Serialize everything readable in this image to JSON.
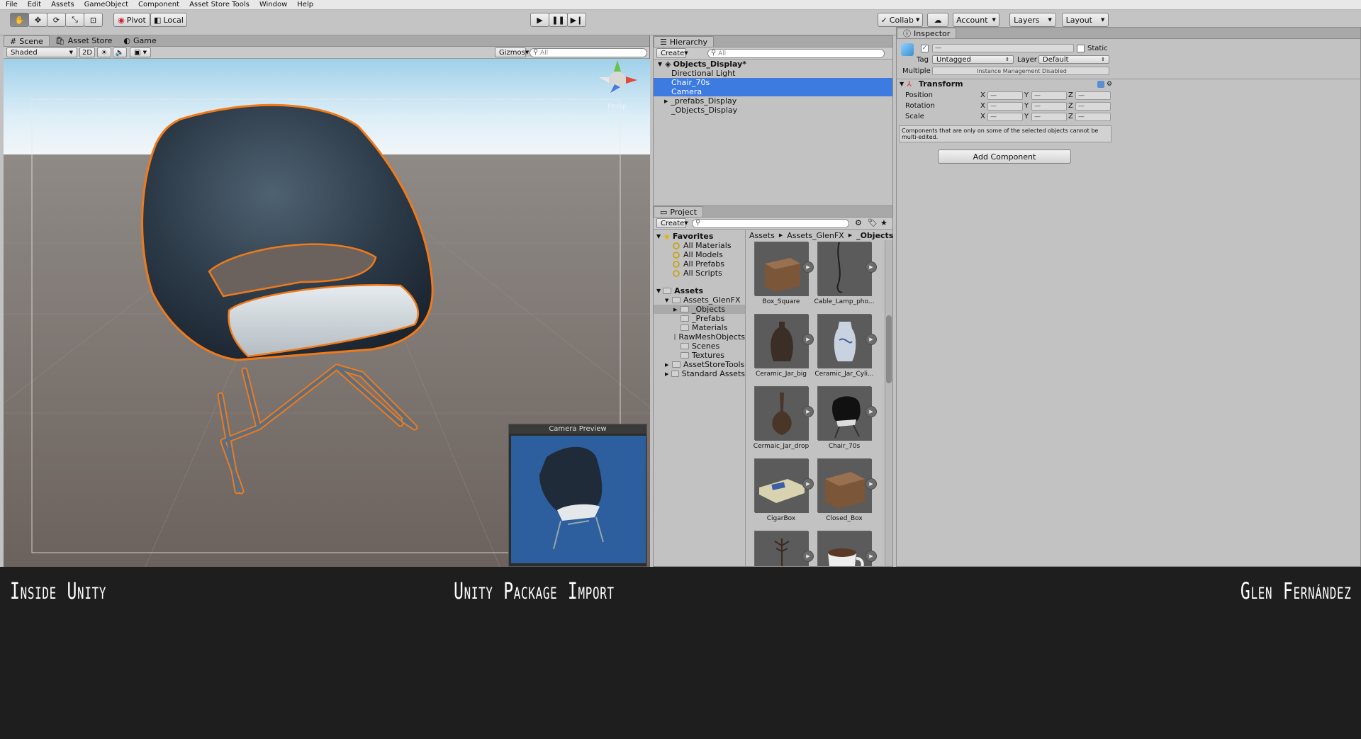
{
  "menu": [
    "File",
    "Edit",
    "Assets",
    "GameObject",
    "Component",
    "Asset Store Tools",
    "Window",
    "Help"
  ],
  "toolbar": {
    "pivot": "Pivot",
    "local": "Local",
    "collab": "Collab",
    "account": "Account",
    "layers": "Layers",
    "layout": "Layout"
  },
  "scene": {
    "tabs": [
      "Scene",
      "Asset Store",
      "Game"
    ],
    "shading": "Shaded",
    "mode2d": "2D",
    "gizmos": "Gizmos",
    "search_placeholder": "All",
    "persp": "Persp",
    "camera_preview_title": "Camera Preview"
  },
  "hierarchy": {
    "title": "Hierarchy",
    "create": "Create",
    "search_placeholder": "All",
    "root": "Objects_Display*",
    "items": [
      {
        "label": "Directional Light",
        "selected": false,
        "expandable": false
      },
      {
        "label": "Chair_70s",
        "selected": true,
        "expandable": false
      },
      {
        "label": "Camera",
        "selected": true,
        "expandable": false
      },
      {
        "label": "_prefabs_Display",
        "selected": false,
        "expandable": true
      },
      {
        "label": "_Objects_Display",
        "selected": false,
        "expandable": false
      }
    ]
  },
  "project": {
    "title": "Project",
    "create": "Create",
    "favorites_label": "Favorites",
    "favorites": [
      "All Materials",
      "All Models",
      "All Prefabs",
      "All Scripts"
    ],
    "assets_label": "Assets",
    "assets_tree": [
      {
        "label": "Assets_GlenFX",
        "level": 1,
        "open": true
      },
      {
        "label": "_Objects",
        "level": 2,
        "selected": true,
        "expandable": true
      },
      {
        "label": "_Prefabs",
        "level": 2
      },
      {
        "label": "Materials",
        "level": 2
      },
      {
        "label": "RawMeshObjects",
        "level": 2
      },
      {
        "label": "Scenes",
        "level": 2
      },
      {
        "label": "Textures",
        "level": 2
      },
      {
        "label": "AssetStoreTools",
        "level": 1,
        "expandable": true
      },
      {
        "label": "Standard Assets",
        "level": 1,
        "expandable": true
      }
    ],
    "breadcrumb": [
      "Assets",
      "Assets_GlenFX",
      "_Objects"
    ],
    "grid": [
      {
        "label": "Box_Square",
        "icon": "box-thumbnail"
      },
      {
        "label": "Cable_Lamp_pho...",
        "icon": "cable-lamp-thumbnail"
      },
      {
        "label": "Ceramic_Jar_big",
        "icon": "ceramic-jar-thumbnail"
      },
      {
        "label": "Ceramic_Jar_Cyli...",
        "icon": "ceramic-jar-cylinder-thumbnail"
      },
      {
        "label": "Cermaic_Jar_drop",
        "icon": "ceramic-jar-drop-thumbnail"
      },
      {
        "label": "Chair_70s",
        "icon": "chair-thumbnail"
      },
      {
        "label": "CigarBox",
        "icon": "cigarbox-thumbnail"
      },
      {
        "label": "Closed_Box",
        "icon": "closed-box-thumbnail"
      },
      {
        "label": "",
        "icon": "coat-rack-thumbnail"
      },
      {
        "label": "",
        "icon": "cup-thumbnail"
      }
    ]
  },
  "inspector": {
    "title": "Inspector",
    "name_value": "—",
    "static_label": "Static",
    "tag_label": "Tag",
    "tag_value": "Untagged",
    "layer_label": "Layer",
    "layer_value": "Default",
    "multiple_label": "Multiple",
    "multiple_value": "Instance Management Disabled",
    "transform_label": "Transform",
    "rows": [
      {
        "label": "Position",
        "x": "—",
        "y": "—",
        "z": "—"
      },
      {
        "label": "Rotation",
        "x": "—",
        "y": "—",
        "z": "—"
      },
      {
        "label": "Scale",
        "x": "—",
        "y": "—",
        "z": "—"
      }
    ],
    "axis_x": "X",
    "axis_y": "Y",
    "axis_z": "Z",
    "note": "Components that are only on some of the selected objects cannot be multi-edited.",
    "add_component": "Add Component"
  },
  "banner": {
    "left": "Inside Unity",
    "center": "Unity Package Import",
    "right": "Glen Fernández"
  },
  "colors": {
    "selection": "#3d7be0",
    "outline": "#f07a1a",
    "banner": "#1e1e1e"
  }
}
